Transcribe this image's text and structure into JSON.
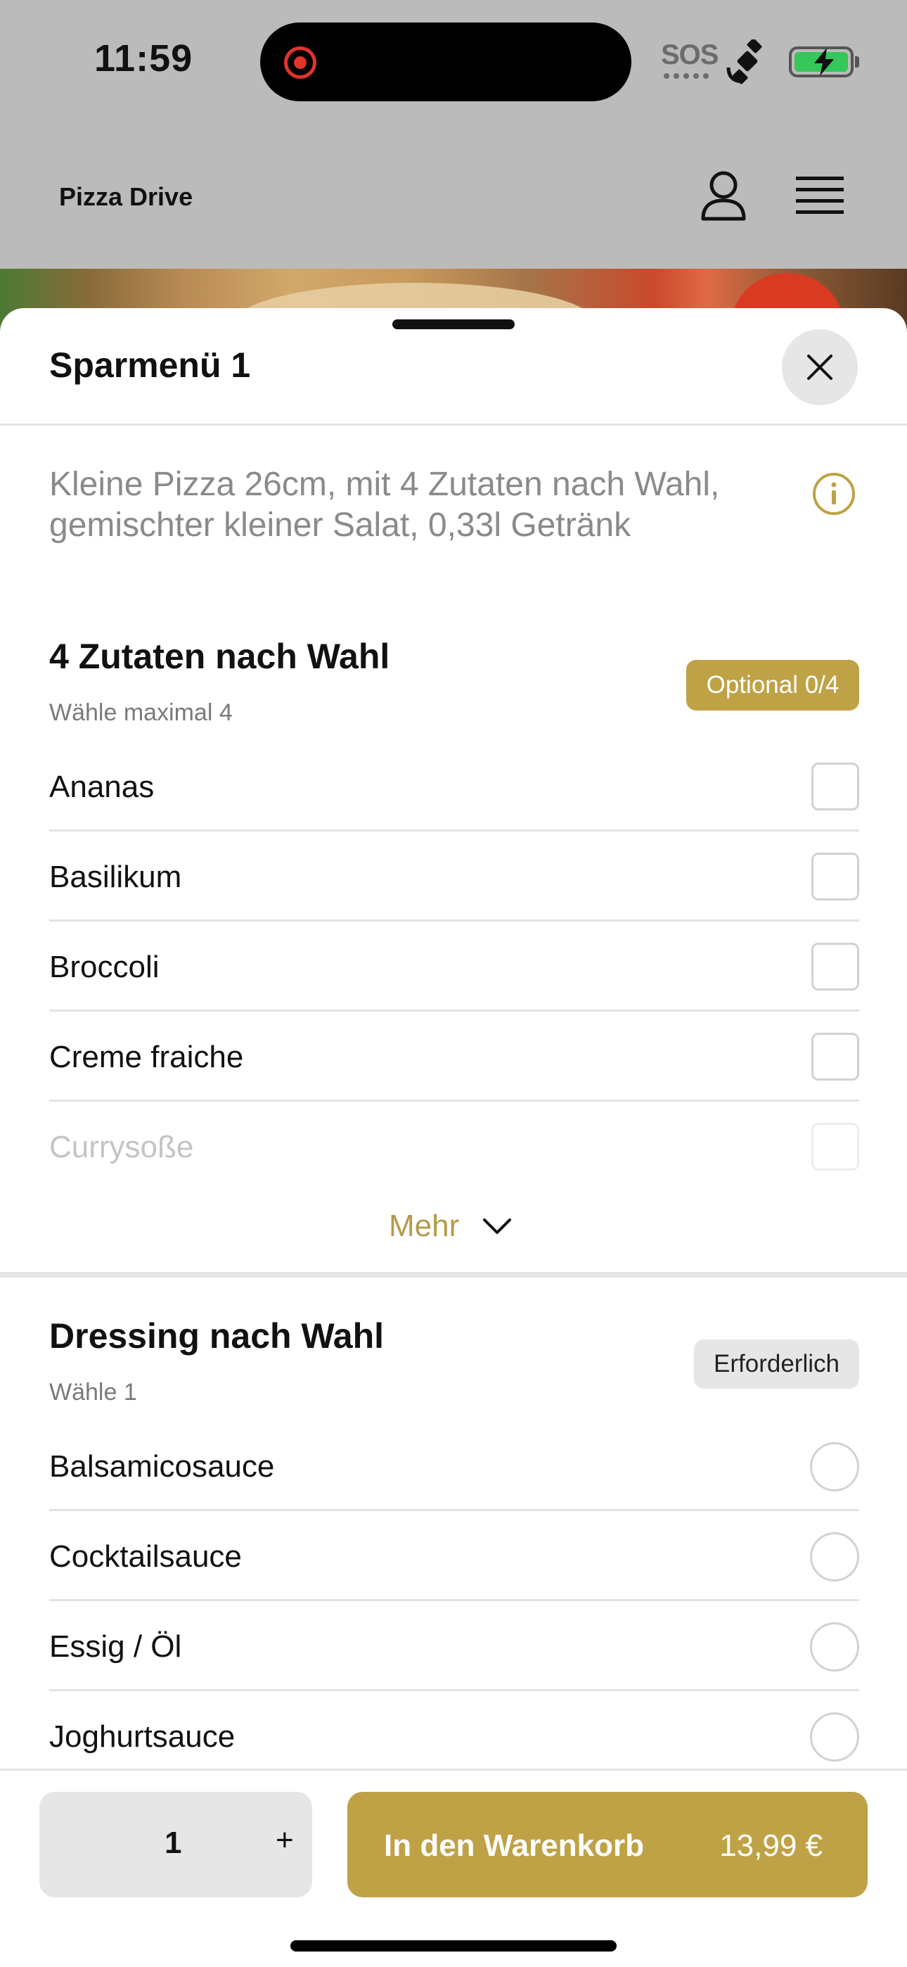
{
  "status_bar": {
    "time": "11:59",
    "sos": "SOS"
  },
  "header": {
    "brand": "Pizza Drive"
  },
  "sheet": {
    "title": "Sparmenü 1",
    "description": "Kleine Pizza 26cm, mit 4 Zutaten nach Wahl, gemischter kleiner Salat, 0,33l Getränk"
  },
  "sections": [
    {
      "title": "4 Zutaten nach Wahl",
      "subtitle": "Wähle maximal 4",
      "badge": "Optional 0/4",
      "options": [
        "Ananas",
        "Basilikum",
        "Broccoli",
        "Creme fraiche",
        "Currysoße"
      ],
      "more_label": "Mehr"
    },
    {
      "title": "Dressing nach Wahl",
      "subtitle": "Wähle 1",
      "badge": "Erforderlich",
      "options": [
        "Balsamicosauce",
        "Cocktailsauce",
        "Essig / Öl",
        "Joghurtsauce"
      ]
    }
  ],
  "footer": {
    "quantity": "1",
    "plus": "+",
    "cart_label": "In den Warenkorb",
    "price": "13,99 €"
  },
  "colors": {
    "accent": "#bfa246",
    "accent_text": "#b49b4a"
  }
}
